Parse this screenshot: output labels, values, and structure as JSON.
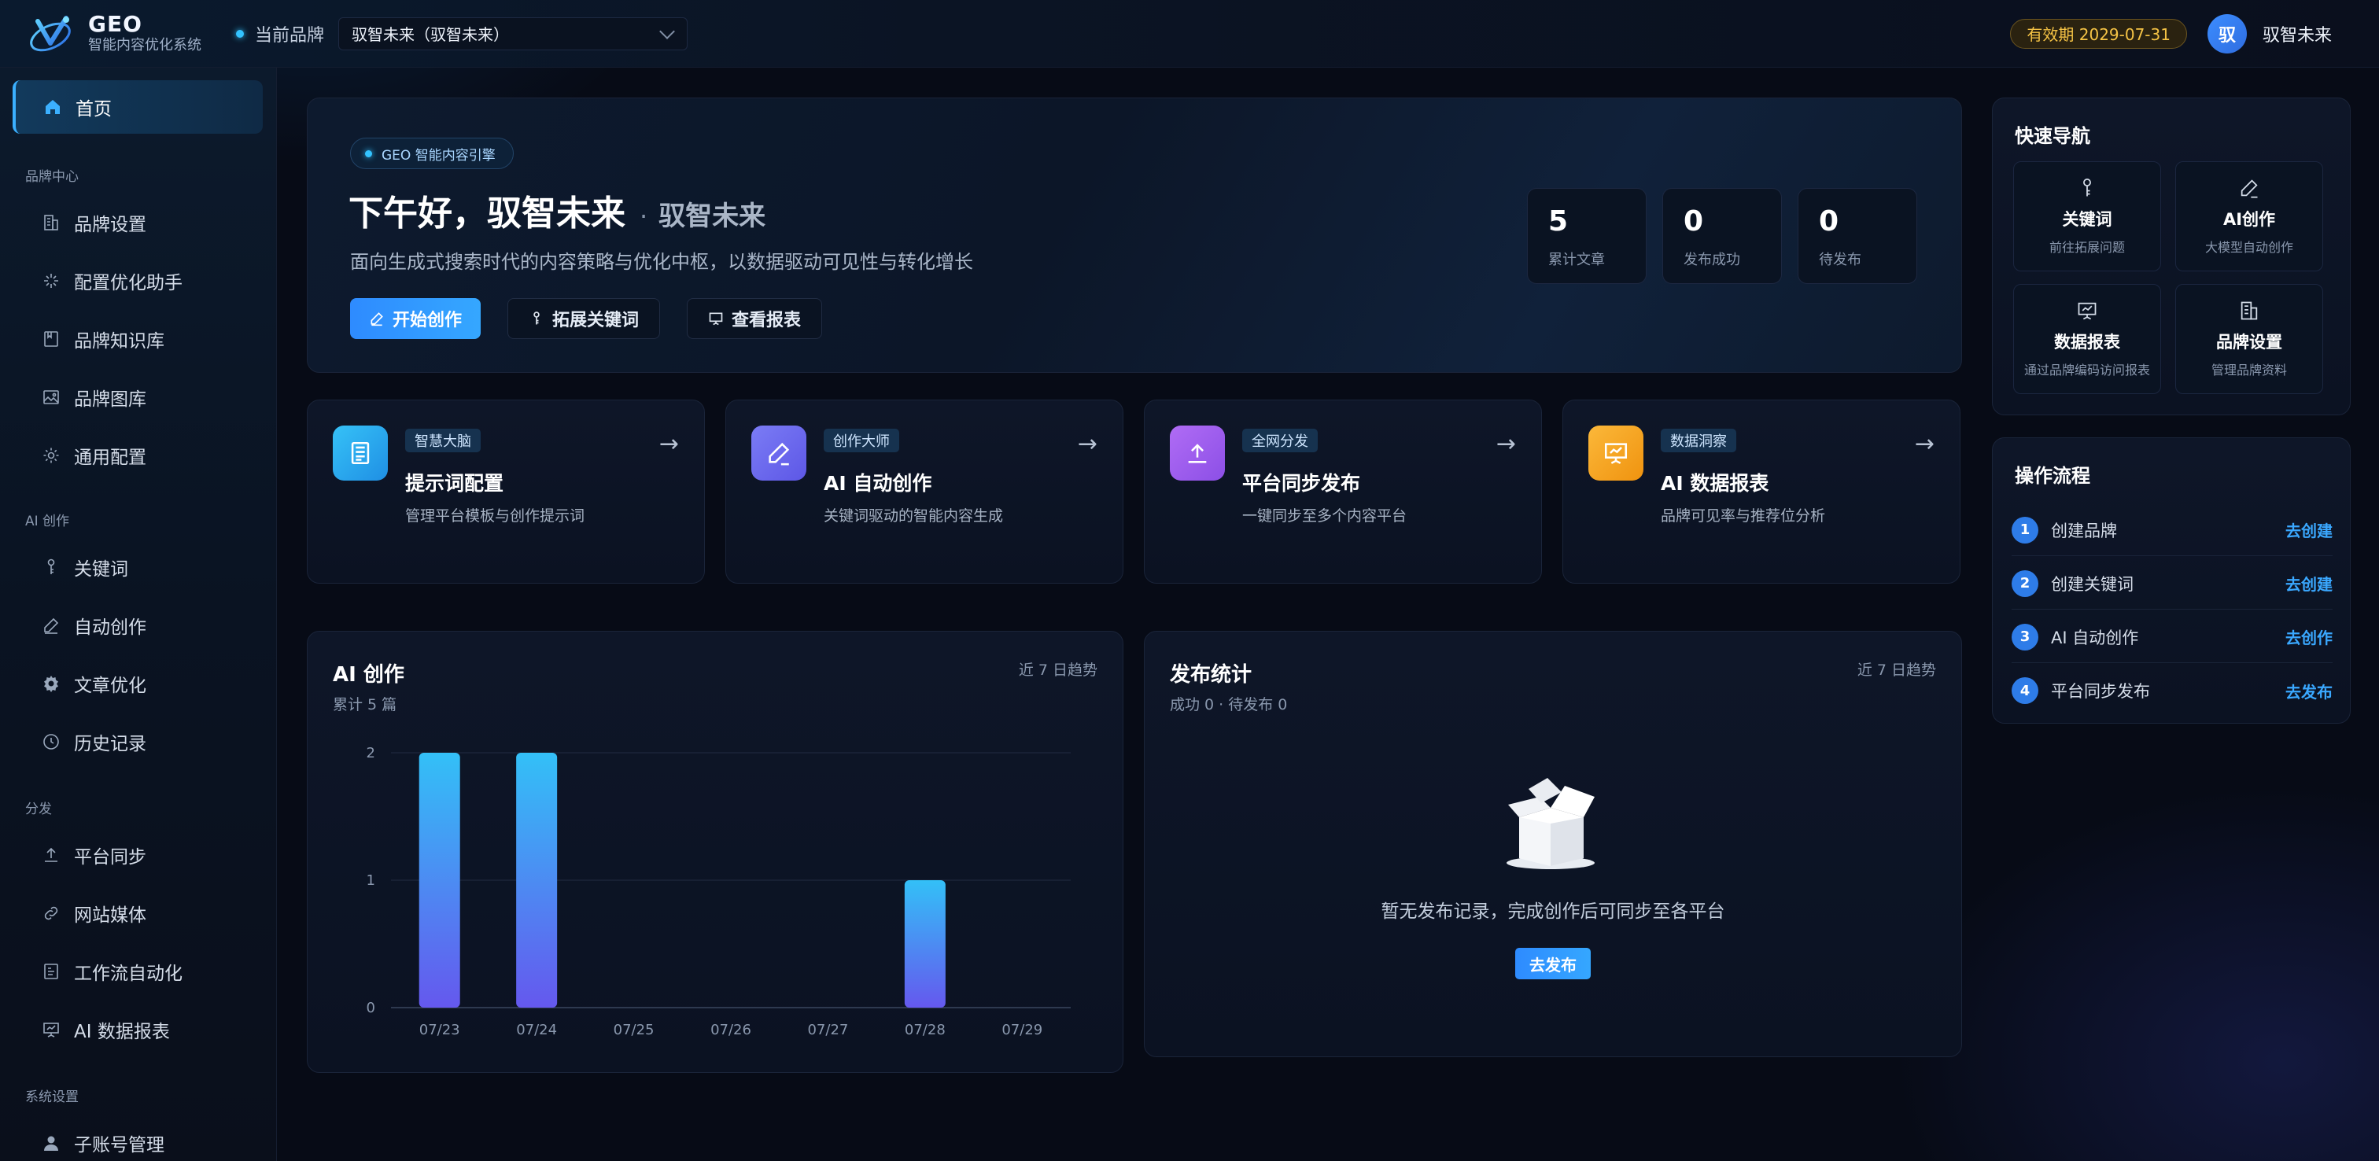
{
  "app": {
    "logo_title": "GEO",
    "logo_subtitle": "智能内容优化系统",
    "current_brand_label": "当前品牌",
    "brand_select_value": "驭智未来（驭智未来）",
    "expiry": "有效期 2029-07-31",
    "avatar_text": "驭",
    "user_name": "驭智未来"
  },
  "sidebar": {
    "home": "首页",
    "sections": [
      {
        "title": "品牌中心",
        "items": [
          "品牌设置",
          "配置优化助手",
          "品牌知识库",
          "品牌图库",
          "通用配置"
        ]
      },
      {
        "title": "AI 创作",
        "items": [
          "关键词",
          "自动创作",
          "文章优化",
          "历史记录"
        ]
      },
      {
        "title": "分发",
        "items": [
          "平台同步",
          "网站媒体",
          "工作流自动化",
          "AI 数据报表"
        ]
      },
      {
        "title": "系统设置",
        "items": [
          "子账号管理"
        ]
      }
    ]
  },
  "hero": {
    "tag": "GEO 智能内容引擎",
    "greeting": "下午好，驭智未来",
    "separator": "·",
    "brand": "驭智未来",
    "description": "面向生成式搜索时代的内容策略与优化中枢，以数据驱动可见性与转化增长",
    "buttons": [
      "开始创作",
      "拓展关键词",
      "查看报表"
    ],
    "stats": [
      {
        "value": "5",
        "label": "累计文章"
      },
      {
        "value": "0",
        "label": "发布成功"
      },
      {
        "value": "0",
        "label": "待发布"
      }
    ]
  },
  "features": [
    {
      "tag": "智慧大脑",
      "title": "提示词配置",
      "desc": "管理平台模板与创作提示词",
      "color": "#2fb0f3",
      "icon": "document-icon"
    },
    {
      "tag": "创作大师",
      "title": "AI 自动创作",
      "desc": "关键词驱动的智能内容生成",
      "color": "#6a68f0",
      "icon": "pen-icon"
    },
    {
      "tag": "全网分发",
      "title": "平台同步发布",
      "desc": "一键同步至多个内容平台",
      "color": "#9d5cf0",
      "icon": "upload-icon"
    },
    {
      "tag": "数据洞察",
      "title": "AI 数据报表",
      "desc": "品牌可见率与推荐位分析",
      "color": "#f5a319",
      "icon": "presentation-icon"
    }
  ],
  "feature_arrow": "→",
  "ai_chart": {
    "title": "AI 创作",
    "subtitle": "累计 5 篇",
    "range": "近 7 日趋势"
  },
  "publish": {
    "title": "发布统计",
    "subtitle": "成功 0 · 待发布 0",
    "range": "近 7 日趋势",
    "empty_text": "暂无发布记录，完成创作后可同步至各平台",
    "empty_button": "去发布"
  },
  "quick_nav": {
    "title": "快速导航",
    "items": [
      {
        "title": "关键词",
        "desc": "前往拓展问题",
        "icon": "key-icon"
      },
      {
        "title": "AI创作",
        "desc": "大模型自动创作",
        "icon": "pen-icon"
      },
      {
        "title": "数据报表",
        "desc": "通过品牌编码访问报表",
        "icon": "presentation-icon"
      },
      {
        "title": "品牌设置",
        "desc": "管理品牌资料",
        "icon": "building-icon"
      }
    ]
  },
  "flow": {
    "title": "操作流程",
    "items": [
      {
        "num": "1",
        "label": "创建品牌",
        "link": "去创建"
      },
      {
        "num": "2",
        "label": "创建关键词",
        "link": "去创建"
      },
      {
        "num": "3",
        "label": "AI 自动创作",
        "link": "去创作"
      },
      {
        "num": "4",
        "label": "平台同步发布",
        "link": "去发布"
      }
    ]
  },
  "chart_data": {
    "type": "bar",
    "categories": [
      "07/23",
      "07/24",
      "07/25",
      "07/26",
      "07/27",
      "07/28",
      "07/29"
    ],
    "values": [
      2,
      2,
      0,
      0,
      0,
      1,
      0
    ],
    "title": "AI 创作",
    "ylim": [
      0,
      2
    ],
    "yticks": [
      0,
      1,
      2
    ],
    "grid": true,
    "colors": {
      "bar_top": "#33c0f7",
      "bar_bottom": "#6558ee"
    }
  }
}
